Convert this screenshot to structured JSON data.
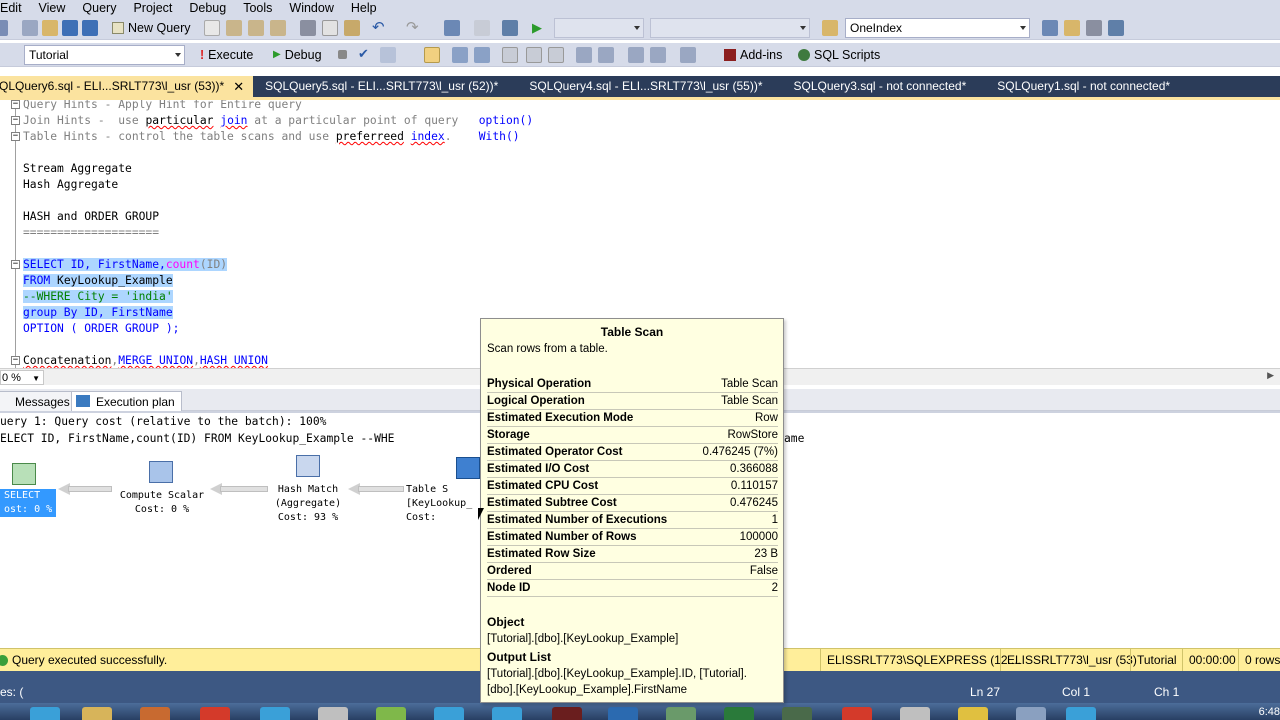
{
  "menu": [
    "Edit",
    "View",
    "Query",
    "Project",
    "Debug",
    "Tools",
    "Window",
    "Help"
  ],
  "toolbar1": {
    "new_query_label": "New Query",
    "combo_right_value": "OneIndex"
  },
  "toolbar2": {
    "database": "Tutorial",
    "execute_label": "Execute",
    "debug_label": "Debug",
    "addins_label": "Add-ins",
    "sqlscripts_label": "SQL Scripts"
  },
  "doc_tabs": [
    {
      "label": "QLQuery6.sql - ELI...SRLT773\\l_usr (53))*",
      "active": true
    },
    {
      "label": "SQLQuery5.sql - ELI...SRLT773\\l_usr (52))*"
    },
    {
      "label": "SQLQuery4.sql - ELI...SRLT773\\l_usr (55))*"
    },
    {
      "label": "SQLQuery3.sql - not connected*"
    },
    {
      "label": "SQLQuery1.sql - not connected*"
    }
  ],
  "editor": {
    "l1": "Query Hints - Apply Hint for Entire query",
    "l2a": "Join Hints -  use ",
    "l2b": "particular",
    "l2c": " ",
    "l2d": "join",
    "l2e": " at a particular point of query   ",
    "l2f": "option()",
    "l3a": "Table Hints - control the table scans and use ",
    "l3b": "preferreed",
    "l3c": " ",
    "l3d": "index",
    "l3e": ".    ",
    "l3f": "With()",
    "l4": "Stream Aggregate",
    "l5": "Hash Aggregate",
    "l6": "HASH and ORDER GROUP",
    "l7": "====================",
    "l8a": "SELECT ID, FirstName,",
    "l8b": "count",
    "l8c": "(ID)",
    "l9a": "FROM ",
    "l9b": "KeyLookup_Example",
    "l10a": "--WHERE City = 'india'",
    "l11a": "group By ID, FirstName",
    "l12a": "OPTION ( ORDER GROUP );",
    "l13a": "Concatenation",
    "l13b": ",",
    "l13c": "MERGE UNION",
    "l13d": ",",
    "l13e": "HASH UNION"
  },
  "zoom": "0 %",
  "result_tabs": {
    "messages": "Messages",
    "plan": "Execution plan"
  },
  "plan": {
    "line1": "uery 1: Query cost (relative to the batch): 100%",
    "line2": "ELECT ID, FirstName,count(ID) FROM KeyLookup_Example --WHE",
    "line2_tail": "ame",
    "nodes": {
      "select": "SELECT\nost: 0 %",
      "compute": "Compute Scalar\nCost: 0 %",
      "hash": "Hash Match\n(Aggregate)\nCost: 93 %",
      "table": "Table S\n[KeyLookup_\nCost:"
    }
  },
  "tooltip": {
    "title": "Table Scan",
    "desc": "Scan rows from a table.",
    "rows": [
      {
        "k": "Physical Operation",
        "v": "Table Scan"
      },
      {
        "k": "Logical Operation",
        "v": "Table Scan"
      },
      {
        "k": "Estimated Execution Mode",
        "v": "Row"
      },
      {
        "k": "Storage",
        "v": "RowStore"
      },
      {
        "k": "Estimated Operator Cost",
        "v": "0.476245 (7%)"
      },
      {
        "k": "Estimated I/O Cost",
        "v": "0.366088"
      },
      {
        "k": "Estimated CPU Cost",
        "v": "0.110157"
      },
      {
        "k": "Estimated Subtree Cost",
        "v": "0.476245"
      },
      {
        "k": "Estimated Number of Executions",
        "v": "1"
      },
      {
        "k": "Estimated Number of Rows",
        "v": "100000"
      },
      {
        "k": "Estimated Row Size",
        "v": "23 B"
      },
      {
        "k": "Ordered",
        "v": "False"
      },
      {
        "k": "Node ID",
        "v": "2"
      }
    ],
    "object_label": "Object",
    "object_value": "[Tutorial].[dbo].[KeyLookup_Example]",
    "output_label": "Output List",
    "output_value1": "[Tutorial].[dbo].[KeyLookup_Example].ID, [Tutorial].",
    "output_value2": "[dbo].[KeyLookup_Example].FirstName"
  },
  "status": {
    "message": "Query executed successfully.",
    "server": "ELISSRLT773\\SQLEXPRESS (12....",
    "user": "ELISSRLT773\\l_usr (53)",
    "db": "Tutorial",
    "time": "00:00:00",
    "rows": "0 rows"
  },
  "bottom": {
    "left": "es: (",
    "ln": "Ln 27",
    "col": "Col 1",
    "ch": "Ch 1"
  },
  "clock": "6:48"
}
